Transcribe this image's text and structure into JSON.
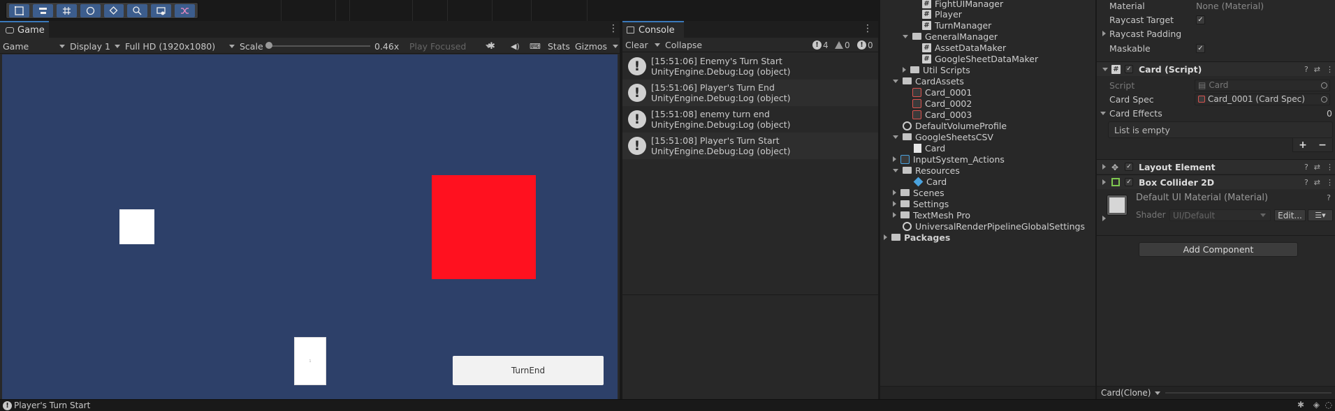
{
  "top_toolbar": {
    "tools": [
      "rect-tool-icon",
      "align-tool-icon",
      "grid-tool-icon",
      "orbit-tool-icon",
      "snap-tool-icon",
      "zoom-tool-icon",
      "capture-tool-icon",
      "shuffle-tool-icon"
    ]
  },
  "game": {
    "tab_label": "Game",
    "mode": "Game",
    "display": "Display 1",
    "resolution": "Full HD (1920x1080)",
    "scale_label": "Scale",
    "scale_value": "0.46x",
    "play_focused": "Play Focused",
    "stats": "Stats",
    "gizmos": "Gizmos",
    "card_text": "1",
    "turnend_label": "TurnEnd",
    "colors": {
      "background": "#2d4069",
      "red_object": "#ff111f",
      "white_object": "#ffffff"
    }
  },
  "console": {
    "tab_label": "Console",
    "clear": "Clear",
    "collapse": "Collapse",
    "count_info": "4",
    "count_warn": "0",
    "count_error": "0",
    "logs": [
      {
        "line1": "[15:51:06] Enemy's Turn Start",
        "line2": "UnityEngine.Debug:Log (object)"
      },
      {
        "line1": "[15:51:06] Player's Turn End",
        "line2": "UnityEngine.Debug:Log (object)"
      },
      {
        "line1": "[15:51:08] enemy turn end",
        "line2": "UnityEngine.Debug:Log (object)"
      },
      {
        "line1": "[15:51:08] Player's Turn Start",
        "line2": "UnityEngine.Debug:Log (object)"
      }
    ]
  },
  "project": {
    "items": [
      {
        "label": "FightUIManager",
        "icon": "script"
      },
      {
        "label": "Player",
        "icon": "script"
      },
      {
        "label": "TurnManager",
        "icon": "script"
      },
      {
        "label": "GeneralManager",
        "icon": "folder"
      },
      {
        "label": "AssetDataMaker",
        "icon": "script"
      },
      {
        "label": "GoogleSheetDataMaker",
        "icon": "script"
      },
      {
        "label": "Util Scripts",
        "icon": "folder"
      },
      {
        "label": "CardAssets",
        "icon": "folder"
      },
      {
        "label": "Card_0001",
        "icon": "asset"
      },
      {
        "label": "Card_0002",
        "icon": "asset"
      },
      {
        "label": "Card_0003",
        "icon": "asset"
      },
      {
        "label": "DefaultVolumeProfile",
        "icon": "gear"
      },
      {
        "label": "GoogleSheetsCSV",
        "icon": "folder"
      },
      {
        "label": "Card",
        "icon": "doc"
      },
      {
        "label": "InputSystem_Actions",
        "icon": "asset"
      },
      {
        "label": "Resources",
        "icon": "folder"
      },
      {
        "label": "Card",
        "icon": "cube"
      },
      {
        "label": "Scenes",
        "icon": "folder"
      },
      {
        "label": "Settings",
        "icon": "folder"
      },
      {
        "label": "TextMesh Pro",
        "icon": "folder"
      },
      {
        "label": "UniversalRenderPipelineGlobalSettings",
        "icon": "gear"
      },
      {
        "label": "Packages",
        "icon": "folder"
      }
    ]
  },
  "inspector": {
    "material_label": "Material",
    "material_value": "None (Material)",
    "raycast_target": "Raycast Target",
    "raycast_padding": "Raycast Padding",
    "maskable": "Maskable",
    "card_script": "Card (Script)",
    "script_label": "Script",
    "script_value": "Card",
    "card_spec_label": "Card Spec",
    "card_spec_value": "Card_0001 (Card Spec)",
    "card_effects_label": "Card Effects",
    "card_effects_count": "0",
    "list_empty": "List is empty",
    "layout_element": "Layout Element",
    "box_collider": "Box Collider 2D",
    "default_material": "Default UI Material (Material)",
    "shader_label": "Shader",
    "shader_value": "UI/Default",
    "edit_button": "Edit...",
    "add_component": "Add Component",
    "selection": "Card(Clone)"
  },
  "status": {
    "message": "Player's Turn Start"
  }
}
